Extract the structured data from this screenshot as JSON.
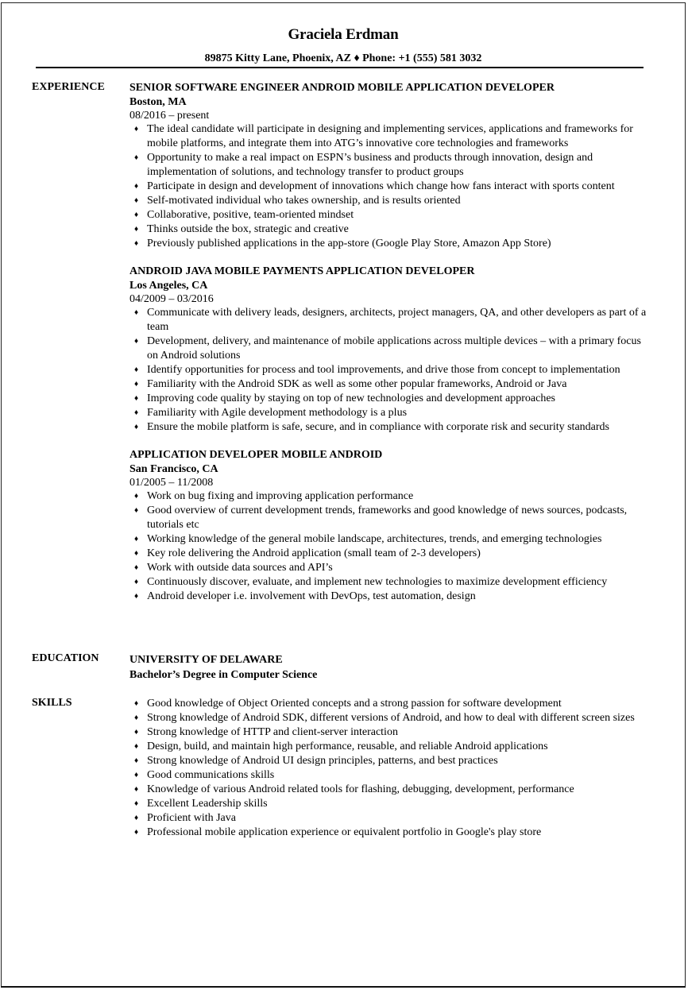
{
  "header": {
    "name": "Graciela Erdman",
    "contact": "89875 Kitty Lane, Phoenix, AZ ♦ Phone: +1 (555) 581 3032"
  },
  "experience": {
    "label": "EXPERIENCE",
    "jobs": [
      {
        "title": "SENIOR SOFTWARE ENGINEER ANDROID MOBILE APPLICATION DEVELOPER",
        "location": "Boston, MA",
        "dates": "08/2016 – present",
        "bullets": [
          "The ideal candidate will participate in designing and implementing services, applications and frameworks for mobile platforms, and integrate them into ATG’s innovative core technologies and frameworks",
          "Opportunity to make a real impact on ESPN’s business and products through innovation, design and implementation of solutions, and technology transfer to product groups",
          "Participate in design and development of innovations which change how fans interact with sports content",
          "Self-motivated individual who takes ownership, and is results oriented",
          "Collaborative, positive, team-oriented mindset",
          "Thinks outside the box, strategic and creative",
          "Previously published applications in the app-store (Google Play Store, Amazon App Store)"
        ]
      },
      {
        "title": "ANDROID JAVA MOBILE PAYMENTS APPLICATION DEVELOPER",
        "location": "Los Angeles, CA",
        "dates": "04/2009 – 03/2016",
        "bullets": [
          "Communicate with delivery leads, designers, architects, project managers, QA, and other developers as part of a team",
          "Development, delivery, and maintenance of mobile applications across multiple devices – with a primary focus on Android solutions",
          "Identify opportunities for process and tool improvements, and drive those from concept to implementation",
          "Familiarity with the Android SDK as well as some other popular frameworks, Android or Java",
          "Improving code quality by staying on top of new technologies and development approaches",
          "Familiarity with Agile development methodology is a plus",
          "Ensure the mobile platform is safe, secure, and in compliance with corporate risk and security standards"
        ]
      },
      {
        "title": "APPLICATION DEVELOPER MOBILE ANDROID",
        "location": "San Francisco, CA",
        "dates": "01/2005 – 11/2008",
        "bullets": [
          "Work on bug fixing and improving application performance",
          "Good overview of current development trends, frameworks and good knowledge of news sources, podcasts, tutorials etc",
          "Working knowledge of the general mobile landscape, architectures, trends, and emerging technologies",
          "Key role delivering the Android application (small team of 2-3 developers)",
          "Work with outside data sources and API’s",
          "Continuously discover, evaluate, and implement new technologies to maximize development efficiency",
          "Android developer i.e. involvement with DevOps, test automation, design"
        ]
      }
    ]
  },
  "education": {
    "label": "EDUCATION",
    "school": "UNIVERSITY OF DELAWARE",
    "degree": "Bachelor’s Degree in Computer Science"
  },
  "skills": {
    "label": "SKILLS",
    "items": [
      "Good knowledge of Object Oriented concepts and a strong passion for software development",
      "Strong knowledge of Android SDK, different versions of Android, and how to deal with different screen sizes",
      "Strong knowledge of HTTP and client-server interaction",
      "Design, build, and maintain high performance, reusable, and reliable Android applications",
      "Strong knowledge of Android UI design principles, patterns, and best practices",
      "Good communications skills",
      "Knowledge of various Android related tools for flashing, debugging, development, performance",
      "Excellent Leadership skills",
      "Proficient with Java",
      "Professional mobile application experience or equivalent portfolio in Google's play store"
    ]
  },
  "bullet_glyph": "♦"
}
